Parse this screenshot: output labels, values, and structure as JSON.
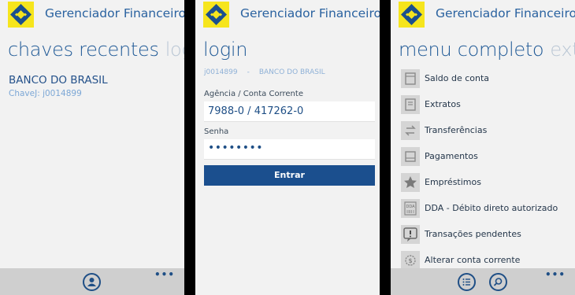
{
  "app": {
    "title": "Gerenciador Financeiro",
    "brand_color": "#f6e51d",
    "accent": "#1f5996"
  },
  "panel1": {
    "pivot_active": "chaves recentes",
    "pivot_next": "login",
    "bank_name": "BANCO DO BRASIL",
    "bank_key": "ChaveJ: j0014899"
  },
  "panel2": {
    "pivot_active": "login",
    "user_key": "j0014899",
    "bank": "BANCO DO BRASIL",
    "account_label": "Agência / Conta Corrente",
    "account_value": "7988-0 / 417262-0",
    "password_label": "Senha",
    "password_value": "••••••••",
    "submit_label": "Entrar"
  },
  "panel3": {
    "pivot_active": "menu completo",
    "pivot_next": "extrat",
    "menu": [
      {
        "label": "Saldo de conta",
        "icon": "document-icon"
      },
      {
        "label": "Extratos",
        "icon": "document-icon"
      },
      {
        "label": "Transferências",
        "icon": "transfer-icon"
      },
      {
        "label": "Pagamentos",
        "icon": "payment-icon"
      },
      {
        "label": "Empréstimos",
        "icon": "star-icon"
      },
      {
        "label": "DDA - Débito direto autorizado",
        "icon": "dda-icon"
      },
      {
        "label": "Transações pendentes",
        "icon": "alert-icon"
      },
      {
        "label": "Alterar conta corrente",
        "icon": "gear-icon"
      }
    ]
  },
  "appbar": {
    "ellipsis": "•••"
  }
}
